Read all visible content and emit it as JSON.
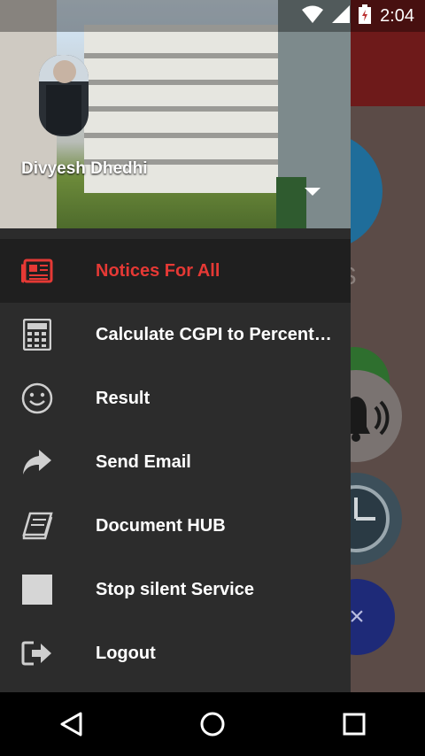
{
  "status_bar": {
    "time": "2:04"
  },
  "background": {
    "letter": "S",
    "fab_symbol": "×"
  },
  "drawer": {
    "user_name": "Divyesh Dhedhi",
    "items": [
      {
        "label": "Notices For All",
        "icon": "newspaper-icon",
        "active": true
      },
      {
        "label": "Calculate CGPI to Percent…",
        "icon": "calculator-icon",
        "active": false
      },
      {
        "label": "Result",
        "icon": "smiley-icon",
        "active": false
      },
      {
        "label": "Send Email",
        "icon": "share-arrow-icon",
        "active": false
      },
      {
        "label": "Document HUB",
        "icon": "book-icon",
        "active": false
      },
      {
        "label": "Stop silent Service",
        "icon": "stop-square-icon",
        "active": false
      },
      {
        "label": "Logout",
        "icon": "logout-icon",
        "active": false
      }
    ]
  },
  "colors": {
    "accent": "#e53935",
    "drawer_bg": "#2c2c2c",
    "active_bg": "#1f1f1f"
  },
  "nav_bar": {
    "back": "back-icon",
    "home": "home-icon",
    "recents": "recents-icon"
  }
}
